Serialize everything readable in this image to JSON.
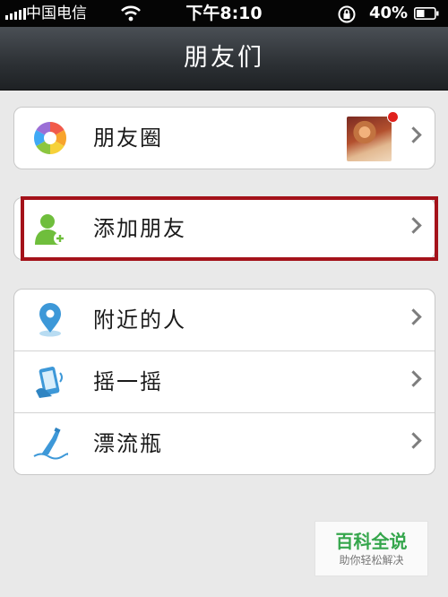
{
  "status_bar": {
    "carrier": "中国电信",
    "time": "下午8:10",
    "battery_percent": "40%",
    "icons": [
      "signal-icon",
      "wifi-icon",
      "rotation-lock-icon",
      "battery-icon"
    ]
  },
  "nav": {
    "title": "朋友们"
  },
  "groups": [
    {
      "items": [
        {
          "label": "朋友圈",
          "icon": "moments-icon",
          "has_thumbnail": true,
          "has_badge": true
        }
      ]
    },
    {
      "items": [
        {
          "label": "添加朋友",
          "icon": "add-friend-icon",
          "highlighted": true
        }
      ]
    },
    {
      "items": [
        {
          "label": "附近的人",
          "icon": "location-pin-icon"
        },
        {
          "label": "摇一摇",
          "icon": "shake-phone-icon"
        },
        {
          "label": "漂流瓶",
          "icon": "drift-bottle-icon"
        }
      ]
    }
  ],
  "colors": {
    "highlight": "#a4121a",
    "badge": "#e0201c",
    "nav_bg": "#2c3034"
  },
  "watermark": {
    "title": "百科全说",
    "subtitle": "助你轻松解决"
  }
}
